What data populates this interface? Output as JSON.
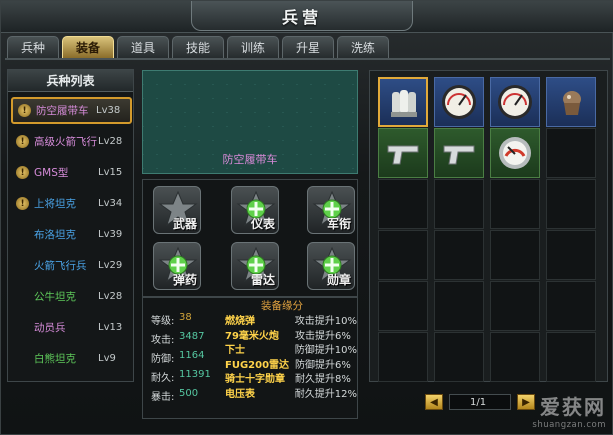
{
  "window": {
    "title": "兵营"
  },
  "tabs": [
    {
      "label": "兵种",
      "active": false
    },
    {
      "label": "装备",
      "active": true
    },
    {
      "label": "道具",
      "active": false
    },
    {
      "label": "技能",
      "active": false
    },
    {
      "label": "训练",
      "active": false
    },
    {
      "label": "升星",
      "active": false
    },
    {
      "label": "洗练",
      "active": false
    }
  ],
  "unit_list": {
    "header": "兵种列表",
    "items": [
      {
        "name": "防空履带车",
        "level": "Lv38",
        "color": "#d58bd8",
        "badge": "!",
        "selected": true
      },
      {
        "name": "高级火箭飞行",
        "level": "Lv28",
        "color": "#d58bd8",
        "badge": "!",
        "selected": false
      },
      {
        "name": "GMS型",
        "level": "Lv15",
        "color": "#d58bd8",
        "badge": "!",
        "selected": false
      },
      {
        "name": "上将坦克",
        "level": "Lv34",
        "color": "#4aa3e6",
        "badge": "!",
        "selected": false
      },
      {
        "name": "布洛坦克",
        "level": "Lv39",
        "color": "#4aa3e6",
        "badge": "",
        "selected": false
      },
      {
        "name": "火箭飞行兵",
        "level": "Lv29",
        "color": "#4aa3e6",
        "badge": "",
        "selected": false
      },
      {
        "name": "公牛坦克",
        "level": "Lv28",
        "color": "#5ec85a",
        "badge": "",
        "selected": false
      },
      {
        "name": "动员兵",
        "level": "Lv13",
        "color": "#d58bd8",
        "badge": "",
        "selected": false
      },
      {
        "name": "白熊坦克",
        "level": "Lv9",
        "color": "#5ec85a",
        "badge": "",
        "selected": false
      }
    ]
  },
  "preview": {
    "unit_name": "防空履带车"
  },
  "equip_slots": [
    {
      "label": "武器",
      "icon": "star-icon",
      "has_plus": false
    },
    {
      "label": "仪表",
      "icon": "star-plus-icon",
      "has_plus": true
    },
    {
      "label": "军衔",
      "icon": "star-plus-icon",
      "has_plus": true
    },
    {
      "label": "弹药",
      "icon": "star-plus-icon",
      "has_plus": true
    },
    {
      "label": "雷达",
      "icon": "star-plus-icon",
      "has_plus": true
    },
    {
      "label": "勋章",
      "icon": "star-plus-icon",
      "has_plus": true
    }
  ],
  "stats": {
    "rows": [
      {
        "label": "等级:",
        "value": "38",
        "color": "#d0a33a"
      },
      {
        "label": "攻击:",
        "value": "3487",
        "color": "#55c7a1"
      },
      {
        "label": "防御:",
        "value": "1164",
        "color": "#55c7a1"
      },
      {
        "label": "耐久:",
        "value": "11391",
        "color": "#55c7a1"
      },
      {
        "label": "暴击:",
        "value": "500",
        "color": "#55c7a1"
      }
    ],
    "bonus_title": "装备缘分",
    "bonuses": [
      {
        "name": "燃烧弹",
        "effect": "攻击提升10%"
      },
      {
        "name": "79毫米火炮",
        "effect": "攻击提升6%"
      },
      {
        "name": "下士",
        "effect": "防御提升10%"
      },
      {
        "name": "FUG200雷达",
        "effect": "防御提升6%"
      },
      {
        "name": "骑士十字勋章",
        "effect": "耐久提升8%"
      },
      {
        "name": "电压表",
        "effect": "耐久提升12%"
      }
    ]
  },
  "inventory": {
    "items": [
      {
        "icon": "ammo-shells-icon",
        "bg": "filled",
        "selected": true
      },
      {
        "icon": "gauge-meter-icon",
        "bg": "filled",
        "selected": false
      },
      {
        "icon": "gauge-meter-icon",
        "bg": "filled",
        "selected": false
      },
      {
        "icon": "medal-helmet-icon",
        "bg": "filled",
        "selected": false
      },
      {
        "icon": "pistol-icon",
        "bg": "green",
        "selected": false
      },
      {
        "icon": "pistol-icon",
        "bg": "green",
        "selected": false
      },
      {
        "icon": "round-gauge-icon",
        "bg": "green",
        "selected": false
      }
    ],
    "page": "1/1"
  },
  "watermark": {
    "cn": "爱获网",
    "en": "shuangzan.com"
  }
}
